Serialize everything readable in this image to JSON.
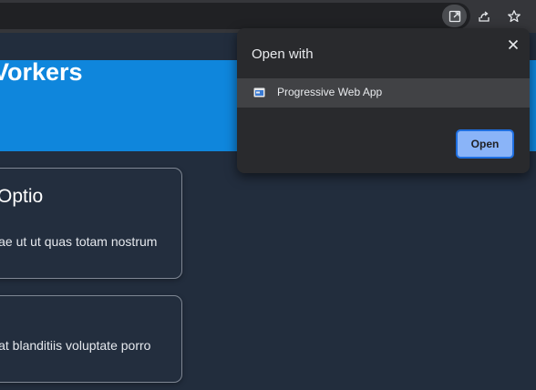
{
  "toolbar": {
    "buttons": [
      {
        "icon": "open-in-app-icon",
        "active": true
      },
      {
        "icon": "share-icon",
        "active": false
      },
      {
        "icon": "bookmark-star-icon",
        "active": false
      }
    ]
  },
  "page": {
    "hero_title": "Vorkers",
    "cards": [
      {
        "title": "Optio",
        "text": "iae ut ut quas totam nostrum"
      },
      {
        "title": "",
        "text": "iat blanditiis voluptate porro"
      }
    ],
    "colors": {
      "hero": "#0f86dc",
      "background": "#222d3d"
    }
  },
  "popup": {
    "title": "Open with",
    "app_label": "Progressive Web App",
    "open_label": "Open",
    "icons": {
      "close": "close-icon",
      "app": "pwa-app-icon"
    }
  }
}
